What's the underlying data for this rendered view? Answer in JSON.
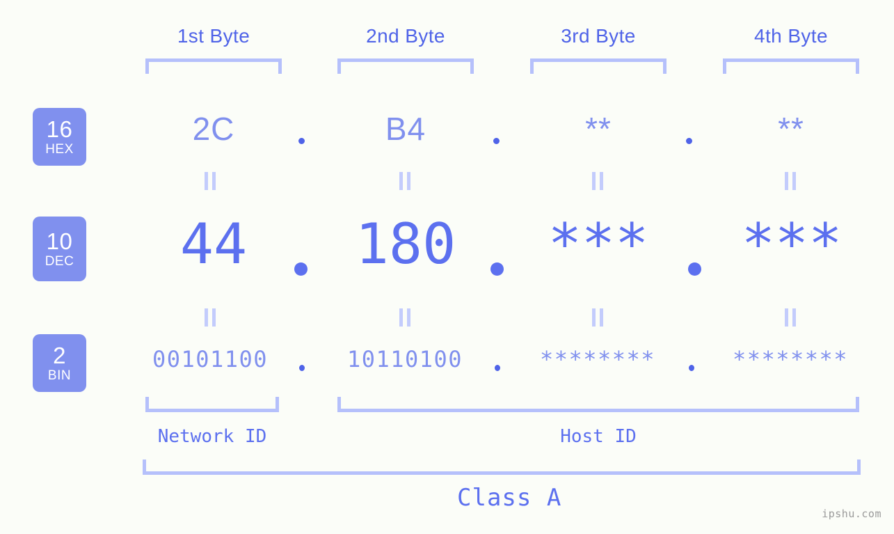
{
  "colors": {
    "background": "#fbfdf8",
    "accent": "#4f63e8",
    "accent_light": "#8090ee",
    "bracket": "#b5c0fb",
    "badge_bg": "#8090ee",
    "badge_text": "#ffffff",
    "eq_mark": "#c3ccfc",
    "watermark": "#9a9a9a"
  },
  "header": {
    "byte_labels": [
      "1st Byte",
      "2nd Byte",
      "3rd Byte",
      "4th Byte"
    ]
  },
  "radix_badges": [
    {
      "number": "16",
      "name": "HEX"
    },
    {
      "number": "10",
      "name": "DEC"
    },
    {
      "number": "2",
      "name": "BIN"
    }
  ],
  "rows": {
    "hex": {
      "radix": "16",
      "label": "HEX",
      "octets": [
        "2C",
        "B4",
        "**",
        "**"
      ],
      "separator": "."
    },
    "dec": {
      "radix": "10",
      "label": "DEC",
      "octets": [
        "44",
        "180",
        "***",
        "***"
      ],
      "separator": "."
    },
    "bin": {
      "radix": "2",
      "label": "BIN",
      "octets": [
        "00101100",
        "10110100",
        "********",
        "********"
      ],
      "separator": "."
    }
  },
  "equality_marks": {
    "glyph": "||",
    "rows": 2,
    "count_per_row": 4
  },
  "footer": {
    "network_id_label": "Network ID",
    "host_id_label": "Host ID",
    "class_label": "Class A"
  },
  "watermark": {
    "text": "ipshu.com"
  },
  "chart_data": {
    "type": "table",
    "title": "IPv4 address octet breakdown",
    "columns": [
      "1st Byte",
      "2nd Byte",
      "3rd Byte",
      "4th Byte"
    ],
    "rows": [
      {
        "radix": 16,
        "name": "HEX",
        "values": [
          "2C",
          "B4",
          "**",
          "**"
        ]
      },
      {
        "radix": 10,
        "name": "DEC",
        "values": [
          "44",
          "180",
          "***",
          "***"
        ]
      },
      {
        "radix": 2,
        "name": "BIN",
        "values": [
          "00101100",
          "10110100",
          "********",
          "********"
        ]
      }
    ],
    "groupings": [
      {
        "label": "Network ID",
        "spans_bytes": [
          1,
          1
        ]
      },
      {
        "label": "Host ID",
        "spans_bytes": [
          2,
          4
        ]
      },
      {
        "label": "Class A",
        "spans_bytes": [
          1,
          4
        ]
      }
    ]
  }
}
